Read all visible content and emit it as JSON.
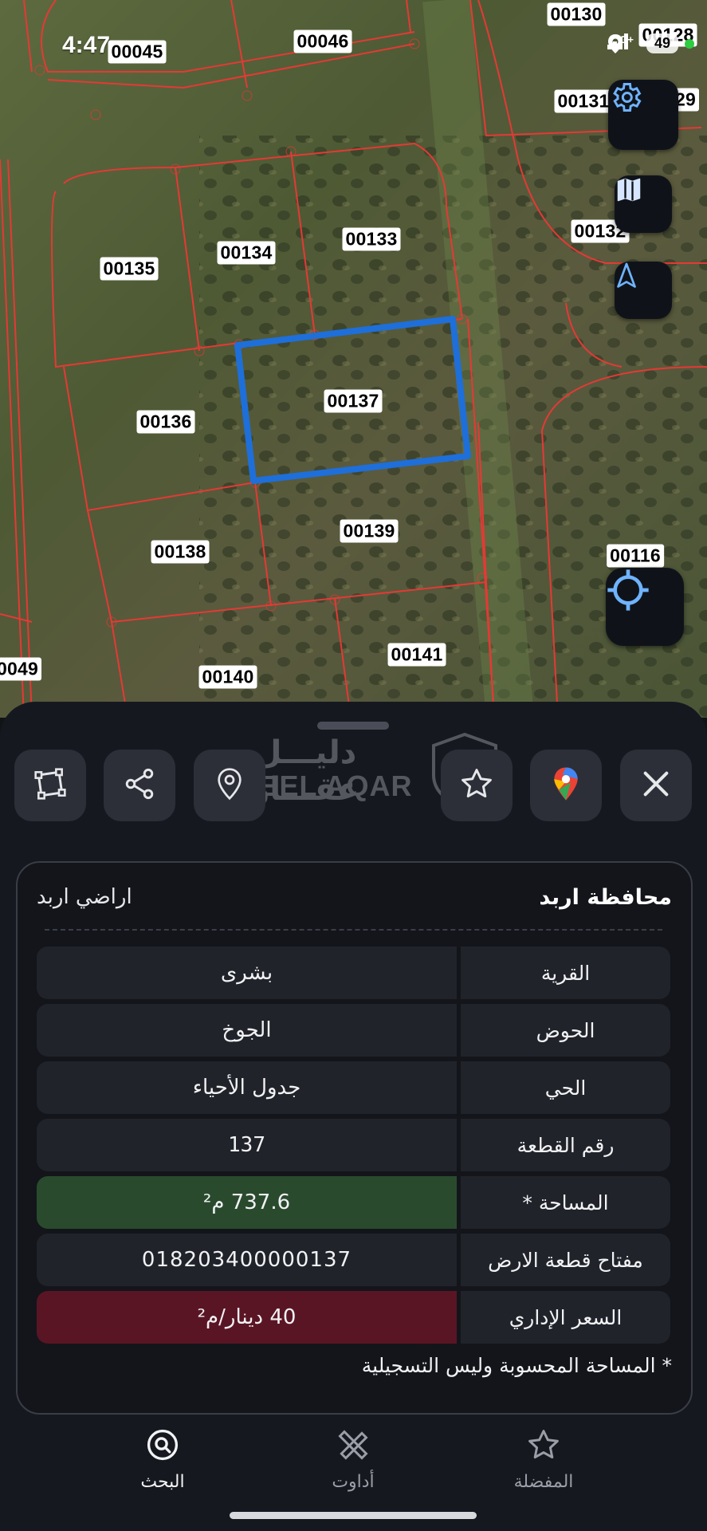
{
  "status_bar": {
    "time": "4:47",
    "network": "4G+",
    "battery": "49"
  },
  "map": {
    "parcels": [
      {
        "id": "00130"
      },
      {
        "id": "00128"
      },
      {
        "id": "00045"
      },
      {
        "id": "00046"
      },
      {
        "id": "00131"
      },
      {
        "id": "29"
      },
      {
        "id": "00134"
      },
      {
        "id": "00133"
      },
      {
        "id": "00135"
      },
      {
        "id": "00132"
      },
      {
        "id": "00137"
      },
      {
        "id": "00136"
      },
      {
        "id": "00139"
      },
      {
        "id": "00138"
      },
      {
        "id": "00116"
      },
      {
        "id": "00141"
      },
      {
        "id": "0049"
      },
      {
        "id": "00140"
      }
    ],
    "selected_parcel": "00137",
    "colors": {
      "parcel_border": "#e53935",
      "selected_border": "#1e6fd9"
    }
  },
  "map_controls": [
    {
      "name": "settings",
      "icon": "gear-icon"
    },
    {
      "name": "layers",
      "icon": "map-icon"
    },
    {
      "name": "north",
      "icon": "navigation-arrow-icon"
    },
    {
      "name": "locate",
      "icon": "crosshair-icon"
    }
  ],
  "action_bar": [
    {
      "name": "measure",
      "icon": "polygon-icon"
    },
    {
      "name": "share",
      "icon": "share-icon"
    },
    {
      "name": "location",
      "icon": "location-pin-icon"
    },
    {
      "name": "favorite",
      "icon": "star-icon"
    },
    {
      "name": "google-maps",
      "icon": "google-maps-icon"
    },
    {
      "name": "close",
      "icon": "close-icon"
    }
  ],
  "watermark": {
    "arabic": "دليـــل عقـــار",
    "english": "DALEEL AQAR"
  },
  "info_card": {
    "governorate": "محافظة اربد",
    "directorate": "اراضي اربد",
    "rows": [
      {
        "label": "القرية",
        "value": "بشرى"
      },
      {
        "label": "الحوض",
        "value": "الجوخ"
      },
      {
        "label": "الحي",
        "value": "جدول الأحياء"
      },
      {
        "label": "رقم القطعة",
        "value": "137"
      },
      {
        "label": "المساحة *",
        "value": "737.6 م²"
      },
      {
        "label": "مفتاح قطعة الارض",
        "value": "018203400000137"
      },
      {
        "label": "السعر الإداري",
        "value": "40 دينار/م²"
      }
    ],
    "note": "* المساحة المحسوبة وليس التسجيلية",
    "colors": {
      "area_highlight": "#2a4a2e",
      "price_highlight": "#5a1524"
    }
  },
  "bottom_nav": [
    {
      "label": "البحث",
      "icon": "search-icon"
    },
    {
      "label": "أداوت",
      "icon": "tools-icon"
    },
    {
      "label": "المفضلة",
      "icon": "star-icon"
    }
  ]
}
